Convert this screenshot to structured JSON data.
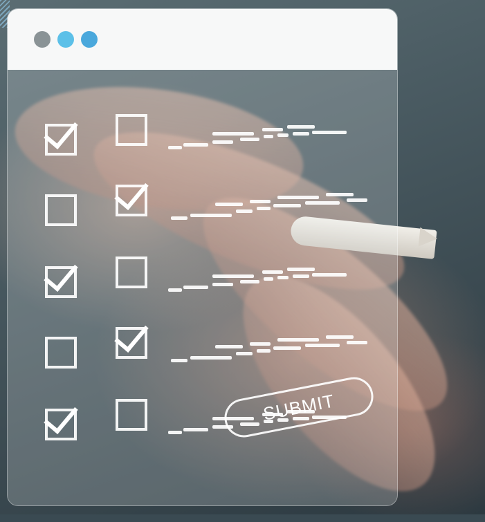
{
  "window": {
    "dots": [
      {
        "name": "dot-gray",
        "color": "#8a9396"
      },
      {
        "name": "dot-blue-1",
        "color": "#5cc0e8"
      },
      {
        "name": "dot-blue-2",
        "color": "#4aa8dc"
      }
    ]
  },
  "form": {
    "rows": [
      {
        "left_checked": true,
        "right_checked": false
      },
      {
        "left_checked": false,
        "right_checked": true
      },
      {
        "left_checked": true,
        "right_checked": false
      },
      {
        "left_checked": false,
        "right_checked": true
      },
      {
        "left_checked": true,
        "right_checked": false
      }
    ],
    "submit_label": "SUBMIT"
  }
}
